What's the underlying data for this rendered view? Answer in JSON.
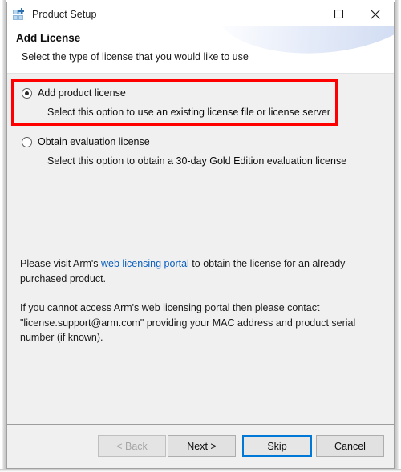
{
  "window": {
    "title": "Product Setup",
    "icon": "product-grid-icon",
    "controls": {
      "minimize": "minimize-icon",
      "maximize": "maximize-icon",
      "close": "close-icon"
    }
  },
  "header": {
    "title": "Add License",
    "subtitle": "Select the type of license that you would like to use"
  },
  "options": [
    {
      "id": "add-product-license",
      "label": "Add product license",
      "description": "Select this option to use an existing license file or license server",
      "selected": true,
      "highlighted": true
    },
    {
      "id": "obtain-evaluation-license",
      "label": "Obtain evaluation license",
      "description": "Select this option to obtain a 30-day Gold Edition evaluation license",
      "selected": false,
      "highlighted": false
    }
  ],
  "paragraphs": {
    "first_pre_link": "Please visit Arm's ",
    "link_text": "web licensing portal",
    "first_post_link": " to obtain the license for an already purchased product.",
    "second": "If you cannot access Arm's web licensing portal then please contact \"license.support@arm.com\" providing your MAC address and product serial number (if known)."
  },
  "footer": {
    "buttons": [
      {
        "id": "back",
        "label": "< Back",
        "state": "disabled"
      },
      {
        "id": "next",
        "label": "Next >",
        "state": "normal"
      },
      {
        "id": "skip",
        "label": "Skip",
        "state": "default"
      },
      {
        "id": "cancel",
        "label": "Cancel",
        "state": "normal"
      }
    ]
  },
  "colors": {
    "highlight": "#fe0000",
    "focus": "#0078d7",
    "link": "#0b5fbe",
    "content_bg": "#f0f0f0"
  }
}
